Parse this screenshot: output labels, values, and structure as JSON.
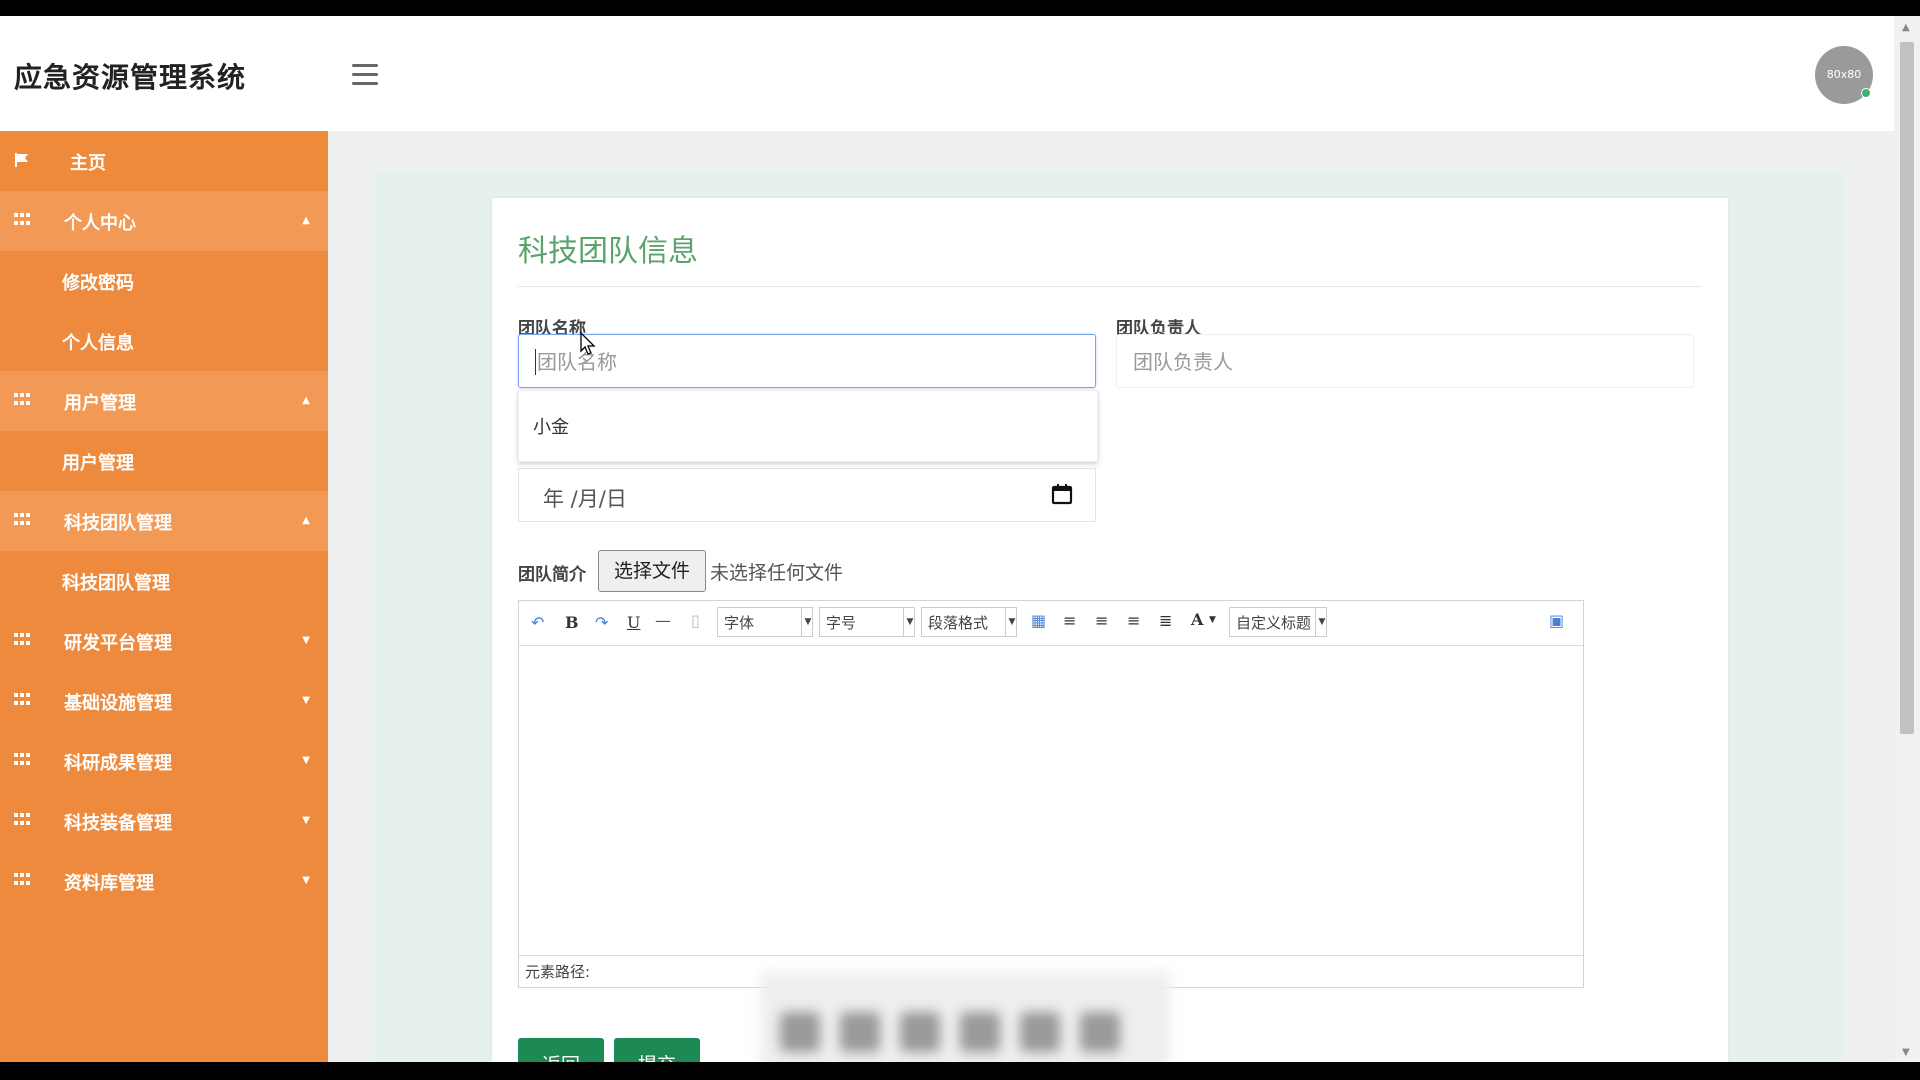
{
  "app": {
    "title": "应急资源管理系统",
    "avatar_text": "80x80"
  },
  "sidebar": {
    "items": [
      {
        "label": "主页"
      },
      {
        "label": "个人中心"
      },
      {
        "label": "修改密码"
      },
      {
        "label": "个人信息"
      },
      {
        "label": "用户管理"
      },
      {
        "label": "用户管理"
      },
      {
        "label": "科技团队管理"
      },
      {
        "label": "科技团队管理"
      },
      {
        "label": "研发平台管理"
      },
      {
        "label": "基础设施管理"
      },
      {
        "label": "科研成果管理"
      },
      {
        "label": "科技装备管理"
      },
      {
        "label": "资料库管理"
      }
    ]
  },
  "form": {
    "title": "科技团队信息",
    "team_name_label": "团队名称",
    "team_name_placeholder": "团队名称",
    "team_leader_label": "团队负责人",
    "team_leader_placeholder": "团队负责人",
    "autocomplete_option": "小金",
    "date_placeholder": "年 /月/日",
    "intro_label": "团队简介",
    "file_button": "选择文件",
    "file_status": "未选择任何文件",
    "editor": {
      "font_select": "字体",
      "size_select": "字号",
      "paragraph_select": "段落格式",
      "custom_heading_select": "自定义标题",
      "element_path": "元素路径:"
    },
    "back_button": "返回",
    "submit_button": "提交"
  }
}
